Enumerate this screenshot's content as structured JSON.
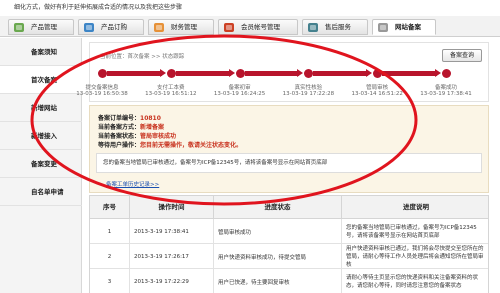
{
  "topnote": "细化方式，做好有利于延伸拓展成合适的情况以及我把这些步骤",
  "tabs": [
    {
      "label": "产品管理",
      "color": "#6aa84f"
    },
    {
      "label": "产品订购",
      "color": "#3d85c6"
    },
    {
      "label": "财务管理",
      "color": "#e69138"
    },
    {
      "label": "会员帐号管理",
      "color": "#cc4125"
    },
    {
      "label": "售后服务",
      "color": "#45818e"
    },
    {
      "label": "网站备案",
      "color": "#999999"
    }
  ],
  "sidebar": {
    "items": [
      {
        "label": "备案须知"
      },
      {
        "label": "首次备案"
      },
      {
        "label": "新增网站"
      },
      {
        "label": "新增接入"
      },
      {
        "label": "备案变更"
      },
      {
        "label": "自名单申请"
      }
    ]
  },
  "progress": {
    "breadcrumb": "当前位置：首次备案 >> 状态跟踪",
    "query_button": "备案查询",
    "steps": [
      {
        "label": "提交备案信息",
        "time": "13-03-19 16:50:38"
      },
      {
        "label": "支付工本费",
        "time": "13-03-19 16:51:12"
      },
      {
        "label": "备案初审",
        "time": "13-03-19 16:24:25"
      },
      {
        "label": "真实性核验",
        "time": "13-03-19 17:22:28"
      },
      {
        "label": "管局审核",
        "time": "13-03-14 16:51:22"
      },
      {
        "label": "备案成功",
        "time": "13-03-19 17:38:41"
      }
    ],
    "completed_steps": 6
  },
  "status": {
    "order_label": "备案订单编号：",
    "order_value": "10810",
    "type_label": "当前备案方式：",
    "type_value": "新增备案",
    "state_label": "当前备案状态：",
    "state_value": "管局审核成功",
    "action_label": "等待用户操作：",
    "action_value": "您目前无需操作，敬请关注状态变化。",
    "notice": "您的备案当地管局已审核通过，备案号为ICP备12345号，请将该备案号显示在网站首页底部",
    "history_link": "备案工单历史记录>>"
  },
  "table": {
    "headers": [
      "序号",
      "操作时间",
      "进度状态",
      "进度说明"
    ],
    "rows": [
      {
        "no": "1",
        "time": "2013-3-19 17:38:41",
        "state": "管局审核成功",
        "desc": "您的备案当地管局已审核通过，备案号为ICP备12345号，请将该备案号显示在网站首页底部"
      },
      {
        "no": "2",
        "time": "2013-3-19 17:26:17",
        "state": "用户快递资料审核成功，待提交管局",
        "desc": "用户快递资料审核已通过，我们将会尽快提交至您所在的管局，请耐心等待工作人员处理后将会通知您所在管局审核"
      },
      {
        "no": "3",
        "time": "2013-3-19 17:22:29",
        "state": "用户已快递，待主要回复审核",
        "desc": "请耐心等待主页显示您的快递资料和关注备案资料的状态，请您耐心等待，同时请您注意您的备案状态"
      }
    ]
  },
  "colors": {
    "accent": "#b8142c",
    "annotation": "#e0141e"
  }
}
